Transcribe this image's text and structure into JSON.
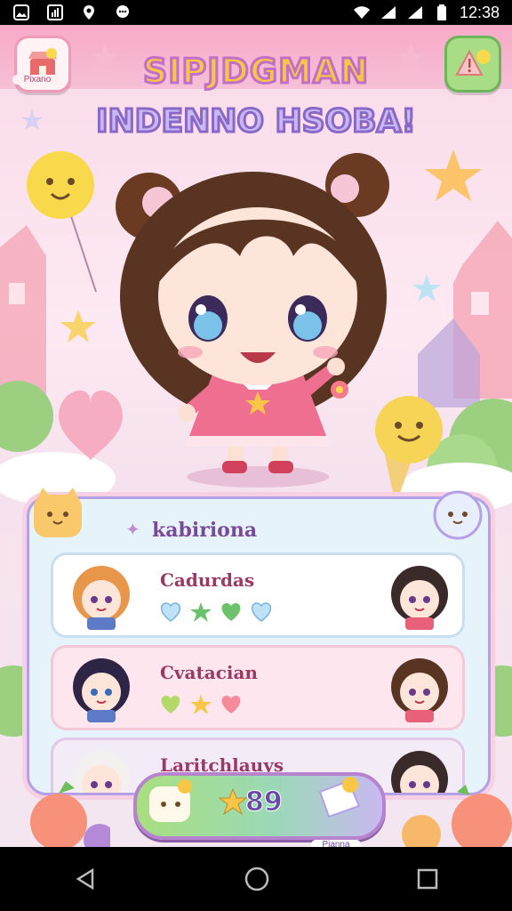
{
  "status_bar": {
    "time": "12:38"
  },
  "header": {
    "corner_left_caption": "Pixano",
    "title_line1": "SIPJDGMAN",
    "title_line2": "INDENNO HSOBA!"
  },
  "panel": {
    "title": "kabiriona",
    "rows": [
      {
        "label": "Cadurdas"
      },
      {
        "label": "Cvatacian"
      },
      {
        "label": "Laritchlauys"
      }
    ]
  },
  "bottom": {
    "score": "89",
    "caption": "Pianna"
  },
  "colors": {
    "pink_bar": "#f7a9c6",
    "title_yellow": "#f8c646",
    "title_lavender": "#c9b9f2",
    "panel_bg": "#e7f3fb",
    "green_button": "#a8dd86"
  },
  "icons": {
    "status_left": [
      "image-icon",
      "chart-icon",
      "location-icon",
      "chat-icon"
    ],
    "status_right": [
      "wifi-icon",
      "signal-icon",
      "signal-icon",
      "battery-icon"
    ],
    "nav": [
      "back-icon",
      "home-icon",
      "recent-apps-icon"
    ]
  }
}
